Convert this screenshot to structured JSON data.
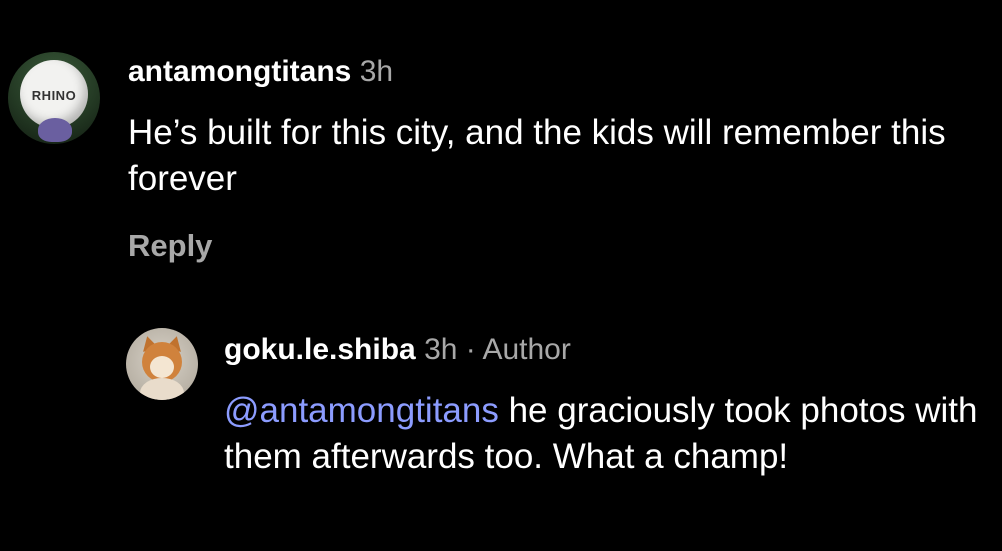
{
  "comment": {
    "username": "antamongtitans",
    "time": "3h",
    "text": "He’s built for this city, and the kids will remember this forever",
    "avatar_label": "RHINO",
    "reply_label": "Reply"
  },
  "reply": {
    "username": "goku.le.shiba",
    "time": "3h",
    "separator": " · ",
    "badge": "Author",
    "mention": "@antamongtitans",
    "text": " he graciously took photos with them afterwards too. What a champ!"
  },
  "colors": {
    "background": "#000000",
    "text": "#ffffff",
    "secondary": "#a8a8a8",
    "mention": "#8c9cff"
  }
}
